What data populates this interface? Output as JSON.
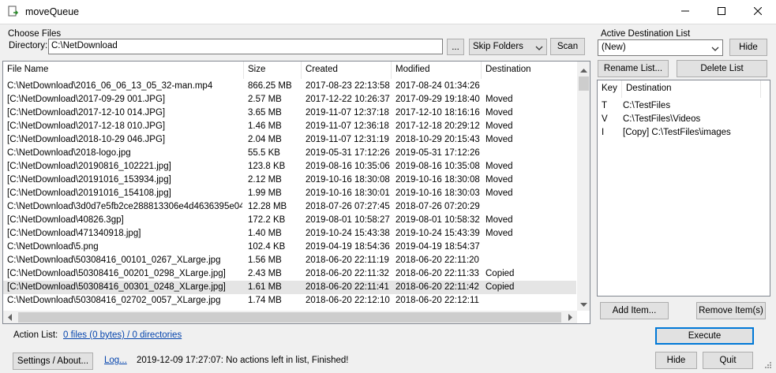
{
  "window": {
    "title": "moveQueue",
    "minimize_icon": "minimize-icon",
    "maximize_icon": "maximize-icon",
    "close_icon": "close-icon"
  },
  "choose_files": {
    "group_label": "Choose Files",
    "directory_label": "Directory:",
    "directory_value": "C:\\NetDownload",
    "browse_label": "...",
    "skip_folders_value": "Skip Folders",
    "scan_label": "Scan"
  },
  "files": {
    "columns": [
      "File Name",
      "Size",
      "Created",
      "Modified",
      "Destination"
    ],
    "rows": [
      {
        "name": "C:\\NetDownload\\2016_06_06_13_05_32-man.mp4",
        "size": "866.25 MB",
        "created": "2017-08-23  22:13:58",
        "modified": "2017-08-24  01:34:26",
        "dest": ""
      },
      {
        "name": "[C:\\NetDownload\\2017-09-29 001.JPG]",
        "size": "2.57 MB",
        "created": "2017-12-22  10:26:37",
        "modified": "2017-09-29  19:18:40",
        "dest": "Moved"
      },
      {
        "name": "[C:\\NetDownload\\2017-12-10 014.JPG]",
        "size": "3.65 MB",
        "created": "2019-11-07  12:37:18",
        "modified": "2017-12-10  18:16:16",
        "dest": "Moved"
      },
      {
        "name": "[C:\\NetDownload\\2017-12-18 010.JPG]",
        "size": "1.46 MB",
        "created": "2019-11-07  12:36:18",
        "modified": "2017-12-18  20:29:12",
        "dest": "Moved"
      },
      {
        "name": "[C:\\NetDownload\\2018-10-29 046.JPG]",
        "size": "2.04 MB",
        "created": "2019-11-07  12:31:19",
        "modified": "2018-10-29  20:15:43",
        "dest": "Moved"
      },
      {
        "name": "C:\\NetDownload\\2018-logo.jpg",
        "size": "55.5 KB",
        "created": "2019-05-31  17:12:26",
        "modified": "2019-05-31  17:12:26",
        "dest": ""
      },
      {
        "name": "[C:\\NetDownload\\20190816_102221.jpg]",
        "size": "123.8 KB",
        "created": "2019-08-16  10:35:06",
        "modified": "2019-08-16  10:35:08",
        "dest": "Moved"
      },
      {
        "name": "[C:\\NetDownload\\20191016_153934.jpg]",
        "size": "2.12 MB",
        "created": "2019-10-16  18:30:08",
        "modified": "2019-10-16  18:30:08",
        "dest": "Moved"
      },
      {
        "name": "[C:\\NetDownload\\20191016_154108.jpg]",
        "size": "1.99 MB",
        "created": "2019-10-16  18:30:01",
        "modified": "2019-10-16  18:30:03",
        "dest": "Moved"
      },
      {
        "name": "C:\\NetDownload\\3d0d7e5fb2ce288813306e4d4636395e04...",
        "size": "12.28 MB",
        "created": "2018-07-26  07:27:45",
        "modified": "2018-07-26  07:20:29",
        "dest": ""
      },
      {
        "name": "[C:\\NetDownload\\40826.3gp]",
        "size": "172.2 KB",
        "created": "2019-08-01  10:58:27",
        "modified": "2019-08-01  10:58:32",
        "dest": "Moved"
      },
      {
        "name": "[C:\\NetDownload\\471340918.jpg]",
        "size": "1.40 MB",
        "created": "2019-10-24  15:43:38",
        "modified": "2019-10-24  15:43:39",
        "dest": "Moved"
      },
      {
        "name": "C:\\NetDownload\\5.png",
        "size": "102.4 KB",
        "created": "2019-04-19  18:54:36",
        "modified": "2019-04-19  18:54:37",
        "dest": ""
      },
      {
        "name": "C:\\NetDownload\\50308416_00101_0267_XLarge.jpg",
        "size": "1.56 MB",
        "created": "2018-06-20  22:11:19",
        "modified": "2018-06-20  22:11:20",
        "dest": ""
      },
      {
        "name": "[C:\\NetDownload\\50308416_00201_0298_XLarge.jpg]",
        "size": "2.43 MB",
        "created": "2018-06-20  22:11:32",
        "modified": "2018-06-20  22:11:33",
        "dest": "Copied"
      },
      {
        "name": "[C:\\NetDownload\\50308416_00301_0248_XLarge.jpg]",
        "size": "1.61 MB",
        "created": "2018-06-20  22:11:41",
        "modified": "2018-06-20  22:11:42",
        "dest": "Copied",
        "selected": true
      },
      {
        "name": "C:\\NetDownload\\50308416_02702_0057_XLarge.jpg",
        "size": "1.74 MB",
        "created": "2018-06-20  22:12:10",
        "modified": "2018-06-20  22:12:11",
        "dest": ""
      }
    ]
  },
  "destinations": {
    "group_label": "Active Destination List",
    "list_value": "(New)",
    "hide_label": "Hide",
    "rename_label": "Rename List...",
    "delete_label": "Delete List",
    "columns": [
      "Key",
      "Destination"
    ],
    "rows": [
      {
        "key": "T",
        "dest": "C:\\TestFiles"
      },
      {
        "key": "V",
        "dest": "C:\\TestFiles\\Videos"
      },
      {
        "key": "I",
        "dest": "[Copy] C:\\TestFiles\\images"
      }
    ],
    "add_label": "Add Item...",
    "remove_label": "Remove Item(s)"
  },
  "actions": {
    "action_list_label": "Action List:",
    "action_list_link": "0 files (0 bytes) / 0 directories",
    "execute_label": "Execute"
  },
  "footer": {
    "settings_label": "Settings / About...",
    "log_label": "Log...",
    "status_text": "2019-12-09 17:27:07: No actions left in list, Finished!",
    "hide_label": "Hide",
    "quit_label": "Quit"
  }
}
